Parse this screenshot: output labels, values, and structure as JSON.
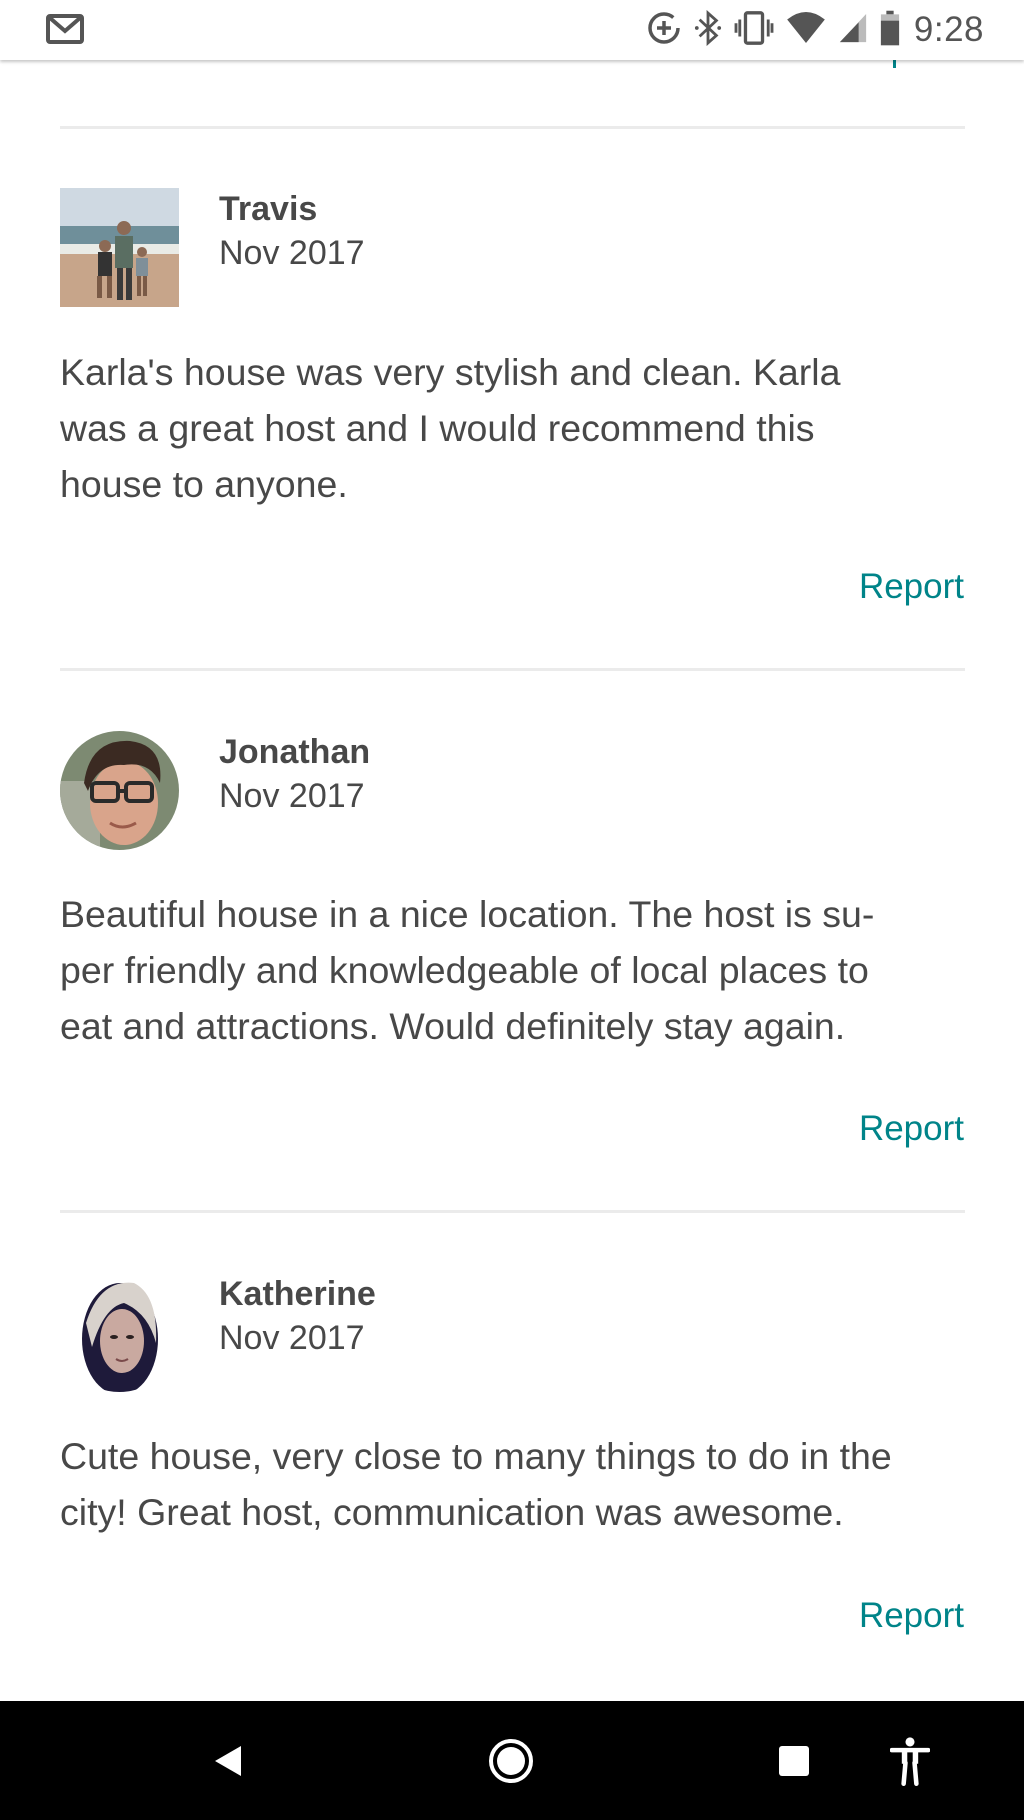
{
  "status_bar": {
    "time": "9:28",
    "icons": [
      "gmail-icon",
      "data-saver-icon",
      "bluetooth-icon",
      "vibrate-icon",
      "wifi-icon",
      "signal-icon",
      "battery-icon"
    ]
  },
  "reviews": [
    {
      "name": "Travis",
      "date": "Nov 2017",
      "text": "Karla's house was very stylish and clean.  Karla\nwas a great host and I would recommend this\nhouse to anyone.",
      "report_label": "Report"
    },
    {
      "name": "Jonathan",
      "date": "Nov 2017",
      "text": "Beautiful house in a nice location. The host is su-\nper friendly and knowledgeable of local places to\neat and attractions. Would definitely stay again.",
      "report_label": "Report"
    },
    {
      "name": "Katherine",
      "date": "Nov 2017",
      "text": "Cute house, very close to many things to do in the\ncity! Great host, communication was awesome.",
      "report_label": "Report"
    }
  ],
  "colors": {
    "accent": "#008489",
    "text": "#484848",
    "divider": "#ebebeb"
  },
  "nav_bar": {
    "buttons": [
      "back-icon",
      "home-icon",
      "recents-icon",
      "accessibility-icon"
    ]
  }
}
